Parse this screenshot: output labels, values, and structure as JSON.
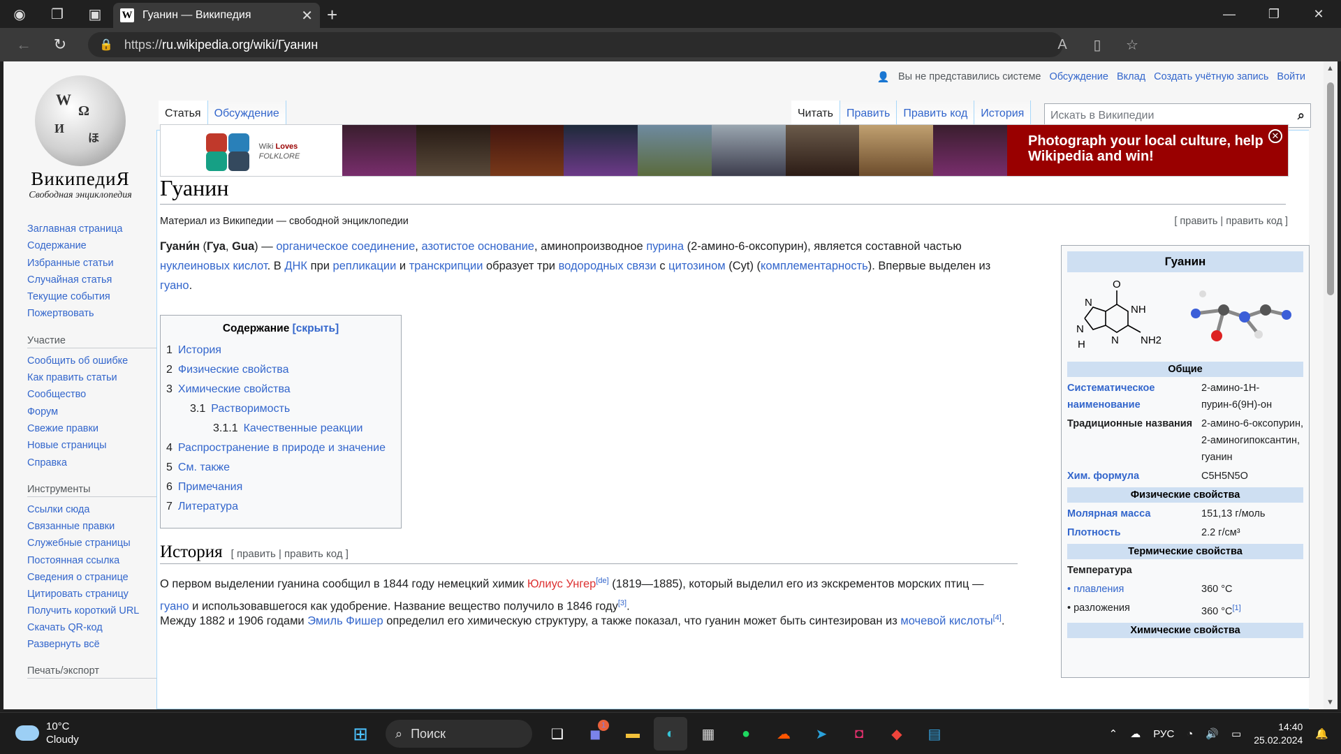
{
  "browser": {
    "tab_title": "Гуанин — Википедия",
    "tab_favicon": "W",
    "url_prefix": "https://",
    "url_host": "ru.wikipedia.org",
    "url_path": "/wiki/Гуанин"
  },
  "logo": {
    "wordmark": "ВикипедиЯ",
    "slogan": "Свободная энциклопедия"
  },
  "personal": {
    "not_logged": "Вы не представились системе",
    "talk": "Обсуждение",
    "contribs": "Вклад",
    "create": "Создать учётную запись",
    "login": "Войти"
  },
  "tabs": {
    "article": "Статья",
    "talk": "Обсуждение",
    "read": "Читать",
    "edit": "Править",
    "edit_code": "Править код",
    "history": "История"
  },
  "search": {
    "placeholder": "Искать в Википедии"
  },
  "sidebar": {
    "nav": [
      "Заглавная страница",
      "Содержание",
      "Избранные статьи",
      "Случайная статья",
      "Текущие события",
      "Пожертвовать"
    ],
    "participate_title": "Участие",
    "participate": [
      "Сообщить об ошибке",
      "Как править статьи",
      "Сообщество",
      "Форум",
      "Свежие правки",
      "Новые страницы",
      "Справка"
    ],
    "tools_title": "Инструменты",
    "tools": [
      "Ссылки сюда",
      "Связанные правки",
      "Служебные страницы",
      "Постоянная ссылка",
      "Сведения о странице",
      "Цитировать страницу",
      "Получить короткий URL",
      "Скачать QR-код",
      "Развернуть всё"
    ],
    "print_title": "Печать/экспорт"
  },
  "banner": {
    "logo_line1": "Wiki",
    "logo_line1b": "Loves",
    "logo_line2": "FOLKLORE",
    "cta": "Photograph your local culture, help Wikipedia and win!"
  },
  "article": {
    "title": "Гуанин",
    "sitesub": "Материал из Википедии — свободной энциклопедии",
    "edit_links": "[ править | править код ]",
    "lead_1": "Гуани́н",
    "lead_2": " (",
    "lead_3": "Гуа",
    "lead_4": ", ",
    "lead_5": "Gua",
    "lead_6": ") — ",
    "lead_links": [
      "органическое соединение",
      "азотистое основание",
      "пурина",
      "нуклеиновых кислот",
      "ДНК",
      "репликации",
      "транскрипции",
      "водородных связи",
      "цитозином",
      "комплементарность",
      "гуано"
    ],
    "lead_t1": ", ",
    "lead_t2": ", аминопроизводное ",
    "lead_t3": " (2-амино-6-оксопурин), является составной частью ",
    "lead_t4": ". В ",
    "lead_t5": " при ",
    "lead_t6": " и ",
    "lead_t7": " образует три ",
    "lead_t8": " с ",
    "lead_t9": " (Cyt) (",
    "lead_t10": "). Впервые выделен из ",
    "lead_t11": "."
  },
  "toc": {
    "title": "Содержание",
    "toggle": "[скрыть]",
    "items": [
      {
        "n": "1",
        "t": "История"
      },
      {
        "n": "2",
        "t": "Физические свойства"
      },
      {
        "n": "3",
        "t": "Химические свойства"
      },
      {
        "n": "3.1",
        "t": "Растворимость"
      },
      {
        "n": "3.1.1",
        "t": "Качественные реакции"
      },
      {
        "n": "4",
        "t": "Распространение в природе и значение"
      },
      {
        "n": "5",
        "t": "См. также"
      },
      {
        "n": "6",
        "t": "Примечания"
      },
      {
        "n": "7",
        "t": "Литература"
      }
    ]
  },
  "history": {
    "title": "История",
    "edit": "[ править | править код ]",
    "p1_a": "О первом выделении гуанина сообщил в 1844 году немецкий химик ",
    "p1_link": "Юлиус Унгер",
    "p1_sup": "[de]",
    "p1_b": " (1819—1885), который выделил его из экскрементов морских птиц — ",
    "p1_link2": "гуано",
    "p1_c": " и использовавшегося как удобрение. Название вещество получило в 1846 году",
    "p1_sup2": "[3]",
    "p1_d": ".",
    "p2_a": "Между 1882 и 1906 годами ",
    "p2_link": "Эмиль Фишер",
    "p2_b": " определил его химическую структуру, а также показал, что гуанин может быть синтезирован из ",
    "p2_link2": "мочевой кислоты",
    "p2_sup": "[4]",
    "p2_c": "."
  },
  "infobox": {
    "title": "Гуанин",
    "formula_labels": [
      "O",
      "N",
      "NH",
      "N",
      "N",
      "NH2",
      "H"
    ],
    "sec_general": "Общие",
    "sys_name_k": "Систематическое наименование",
    "sys_name_v": "2-амино-1H-пурин-6(9H)-он",
    "trad_k": "Традиционные названия",
    "trad_v": "2-амино-6-оксопурин, 2-аминогипоксантин, гуанин",
    "formula_k": "Хим. формула",
    "formula_v": "C5H5N5O",
    "sec_phys": "Физические свойства",
    "molar_k": "Молярная масса",
    "molar_v": "151,13 г/моль",
    "density_k": "Плотность",
    "density_v": "2.2 г/см³",
    "sec_therm": "Термические свойства",
    "temp_k": "Температура",
    "melt_k": "• плавления",
    "melt_v": "360 °C",
    "decomp_k": "• разложения",
    "decomp_v": "360 °C",
    "decomp_sup": "[1]",
    "sec_chem": "Химические свойства"
  },
  "taskbar": {
    "temp": "10°C",
    "cond": "Cloudy",
    "search": "Поиск",
    "lang": "РУС",
    "time": "14:40",
    "date": "25.02.2024",
    "badge": "1"
  }
}
